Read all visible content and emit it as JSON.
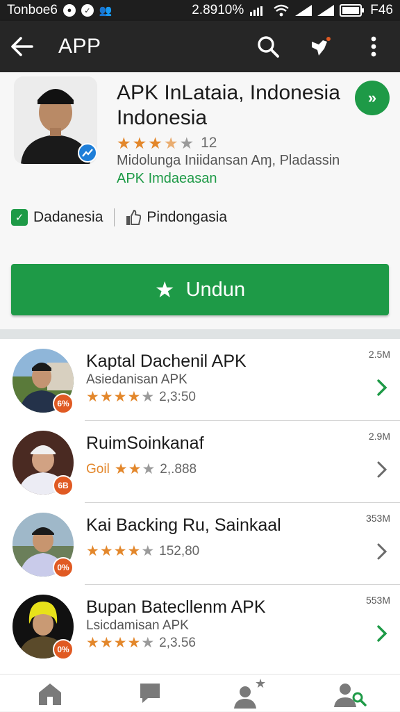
{
  "status_bar": {
    "carrier": "Tonboe6",
    "battery_pct": "2.8910%",
    "network": "F46"
  },
  "app_bar": {
    "title": "APP",
    "back_icon": "arrow-left-icon",
    "search_icon": "search-icon",
    "share_icon": "bird-notification-icon",
    "more_icon": "more-vertical-icon"
  },
  "app": {
    "title": "APK InLataia, Indonesia Indonesia",
    "rating": "3.5",
    "rating_count": "12",
    "developer": "Midolunga Iniidansan Aɱ, Pladassin",
    "category": "APK Imdaeasan",
    "chip1": "Dadanesia",
    "chip2": "Pindongasia",
    "install_label": "Undun",
    "accent_color": "#1e9a47",
    "star_color": "#e3872b"
  },
  "list": [
    {
      "name": "Kaptal Dachenil APK",
      "sub": "Asiedanisan APK",
      "genre": "",
      "rating_text": "2,3:50",
      "stars": 4,
      "size": "2.5M",
      "badge": "6%",
      "chevron_color": "#1e9a47"
    },
    {
      "name": "RuimSoinkanaf",
      "sub": "",
      "genre": "Goil",
      "rating_text": "2,.888",
      "stars": 2,
      "size": "2.9M",
      "badge": "6B",
      "chevron_color": "#6a6a6a"
    },
    {
      "name": "Kai Backing Ru, Sainkaal",
      "sub": "",
      "genre": "",
      "rating_text": "152,80",
      "stars": 4,
      "size": "353M",
      "badge": "0%",
      "chevron_color": "#6a6a6a"
    },
    {
      "name": "Bupan Batecllenm APK",
      "sub": "Lsicdamisan APK",
      "genre": "",
      "rating_text": "2,3.56",
      "stars": 4,
      "size": "553M",
      "badge": "0%",
      "chevron_color": "#1e9a47"
    }
  ],
  "bottom_nav": [
    {
      "icon": "home-icon"
    },
    {
      "icon": "chat-icon"
    },
    {
      "icon": "user-star-icon"
    },
    {
      "icon": "user-search-icon"
    }
  ]
}
